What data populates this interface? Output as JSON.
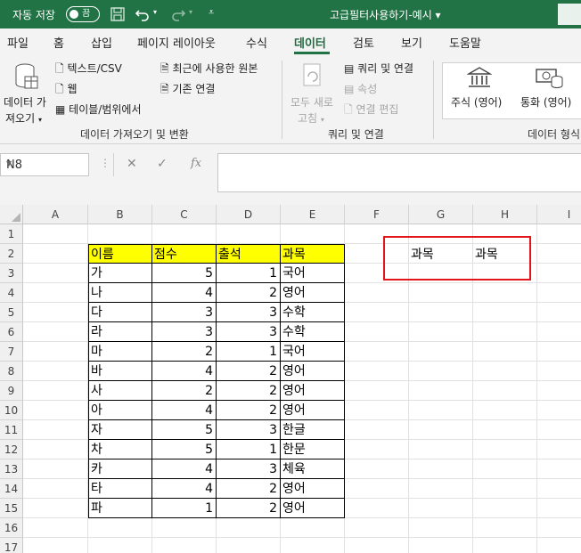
{
  "titlebar": {
    "autosave_label": "자동 저장",
    "autosave_state": "끔",
    "file_title": "고급필터사용하기-예시"
  },
  "tabs": [
    "파일",
    "홈",
    "삽입",
    "페이지 레이아웃",
    "수식",
    "데이터",
    "검토",
    "보기",
    "도움말"
  ],
  "active_tab": "데이터",
  "ribbon": {
    "get_data_line1": "데이터 가",
    "get_data_line2": "져오기",
    "text_csv": "텍스트/CSV",
    "web": "웹",
    "table_range": "테이블/범위에서",
    "recent_sources": "최근에 사용한 원본",
    "existing_connections": "기존 연결",
    "group_get_transform": "데이터 가져오기 및 변환",
    "refresh_all_line1": "모두 새로",
    "refresh_all_line2": "고침",
    "queries_connections": "쿼리 및 연결",
    "properties": "속성",
    "edit_links": "연결 편집",
    "group_queries": "쿼리 및 연결",
    "stocks": "주식 (영어)",
    "currencies": "통화 (영어)",
    "group_data_types": "데이터 형식"
  },
  "formula_bar": {
    "name_box": "N8",
    "fx": "fx",
    "cancel": "✕",
    "enter": "✓",
    "formula": ""
  },
  "columns": [
    "A",
    "B",
    "C",
    "D",
    "E",
    "F",
    "G",
    "H",
    "I"
  ],
  "rows": [
    "1",
    "2",
    "3",
    "4",
    "5",
    "6",
    "7",
    "8",
    "9",
    "10",
    "11",
    "12",
    "13",
    "14",
    "15",
    "16",
    "17"
  ],
  "table": {
    "headers": [
      "이름",
      "점수",
      "출석",
      "과목"
    ],
    "rows": [
      [
        "가",
        "5",
        "1",
        "국어"
      ],
      [
        "나",
        "4",
        "2",
        "영어"
      ],
      [
        "다",
        "3",
        "3",
        "수학"
      ],
      [
        "라",
        "3",
        "3",
        "수학"
      ],
      [
        "마",
        "2",
        "1",
        "국어"
      ],
      [
        "바",
        "4",
        "2",
        "영어"
      ],
      [
        "사",
        "2",
        "2",
        "영어"
      ],
      [
        "아",
        "4",
        "2",
        "영어"
      ],
      [
        "자",
        "5",
        "3",
        "한글"
      ],
      [
        "차",
        "5",
        "1",
        "한문"
      ],
      [
        "카",
        "4",
        "3",
        "체육"
      ],
      [
        "타",
        "4",
        "2",
        "영어"
      ],
      [
        "파",
        "1",
        "2",
        "영어"
      ]
    ]
  },
  "criteria": {
    "g2": "과목",
    "h2": "과목"
  },
  "colors": {
    "excel_green": "#217346",
    "header_fill": "#ffff00",
    "highlight_border": "#e0161b"
  }
}
